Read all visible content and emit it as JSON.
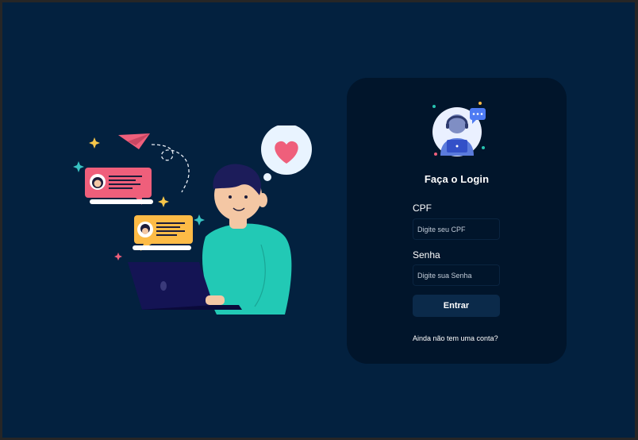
{
  "login": {
    "title": "Faça o Login",
    "cpf_label": "CPF",
    "cpf_placeholder": "Digite seu CPF",
    "password_label": "Senha",
    "password_placeholder": "Digite sua Senha",
    "submit_label": "Entrar",
    "signup_link": "Ainda não tem uma conta?"
  },
  "icons": {
    "illustration": "person-with-laptop-chat-illustration",
    "avatar": "support-agent-avatar-icon"
  },
  "colors": {
    "background": "#03213f",
    "card": "#01152b",
    "button": "#0b2a4a",
    "text": "#ffffff"
  }
}
